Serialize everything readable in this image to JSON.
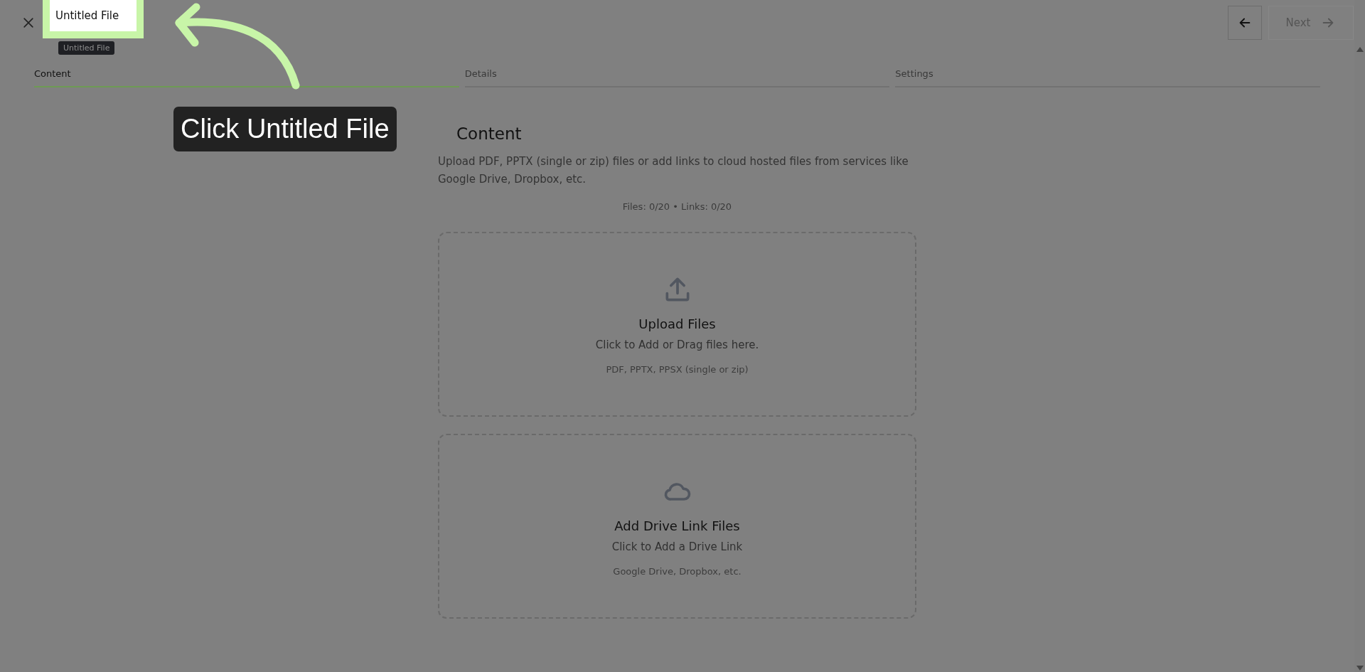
{
  "header": {
    "title_field": {
      "value": "Untitled File"
    },
    "tooltip": "Untitled File",
    "back_button": {
      "disabled": false
    },
    "next_button": {
      "label": "Next",
      "disabled": true
    }
  },
  "steps": [
    {
      "label": "Content",
      "selected": true
    },
    {
      "label": "Details",
      "selected": false
    },
    {
      "label": "Settings",
      "selected": false
    }
  ],
  "section": {
    "title": "Content",
    "description": "Upload PDF, PPTX (single or zip) files or add links to cloud hosted files from services like Google Drive, Dropbox, etc.",
    "counter": "Files: 0/20 • Links: 0/20"
  },
  "dropzones": [
    {
      "kind": "upload",
      "title": "Upload Files",
      "action": "Click to Add or Drag files here.",
      "hint": "PDF, PPTX, PPSX (single or zip)"
    },
    {
      "kind": "link",
      "title": "Add Drive Link Files",
      "action": "Click to Add a Drive Link",
      "hint": "Google Drive, Dropbox, etc."
    }
  ],
  "guide": {
    "caption": "Click Untitled File"
  }
}
